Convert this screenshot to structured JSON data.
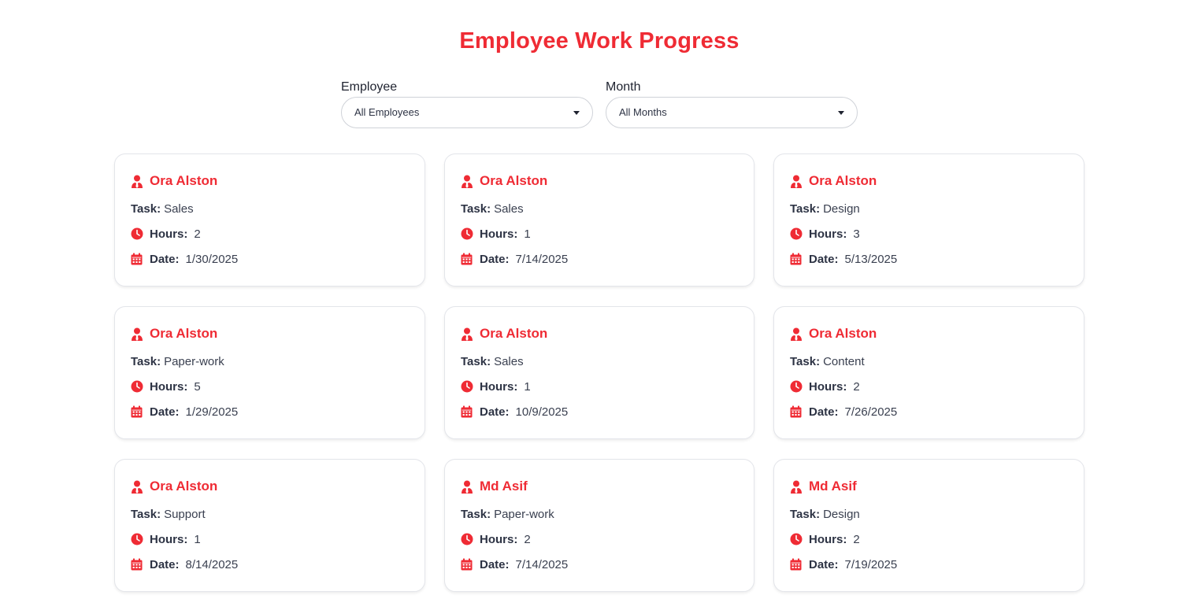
{
  "header": {
    "title": "Employee Work Progress"
  },
  "filters": {
    "employee": {
      "label": "Employee",
      "value": "All Employees"
    },
    "month": {
      "label": "Month",
      "value": "All Months"
    }
  },
  "labels": {
    "task": "Task:",
    "hours": "Hours:",
    "date": "Date:"
  },
  "icons": {
    "name": "user-tie-icon",
    "hours": "clock-icon",
    "date": "calendar-icon"
  },
  "colors": {
    "accent": "#ef2b34",
    "text": "#2d3344"
  },
  "cards": [
    {
      "name": "Ora Alston",
      "task": "Sales",
      "hours": "2",
      "date": "1/30/2025"
    },
    {
      "name": "Ora Alston",
      "task": "Sales",
      "hours": "1",
      "date": "7/14/2025"
    },
    {
      "name": "Ora Alston",
      "task": "Design",
      "hours": "3",
      "date": "5/13/2025"
    },
    {
      "name": "Ora Alston",
      "task": "Paper-work",
      "hours": "5",
      "date": "1/29/2025"
    },
    {
      "name": "Ora Alston",
      "task": "Sales",
      "hours": "1",
      "date": "10/9/2025"
    },
    {
      "name": "Ora Alston",
      "task": "Content",
      "hours": "2",
      "date": "7/26/2025"
    },
    {
      "name": "Ora Alston",
      "task": "Support",
      "hours": "1",
      "date": "8/14/2025"
    },
    {
      "name": "Md Asif",
      "task": "Paper-work",
      "hours": "2",
      "date": "7/14/2025"
    },
    {
      "name": "Md Asif",
      "task": "Design",
      "hours": "2",
      "date": "7/19/2025"
    }
  ]
}
